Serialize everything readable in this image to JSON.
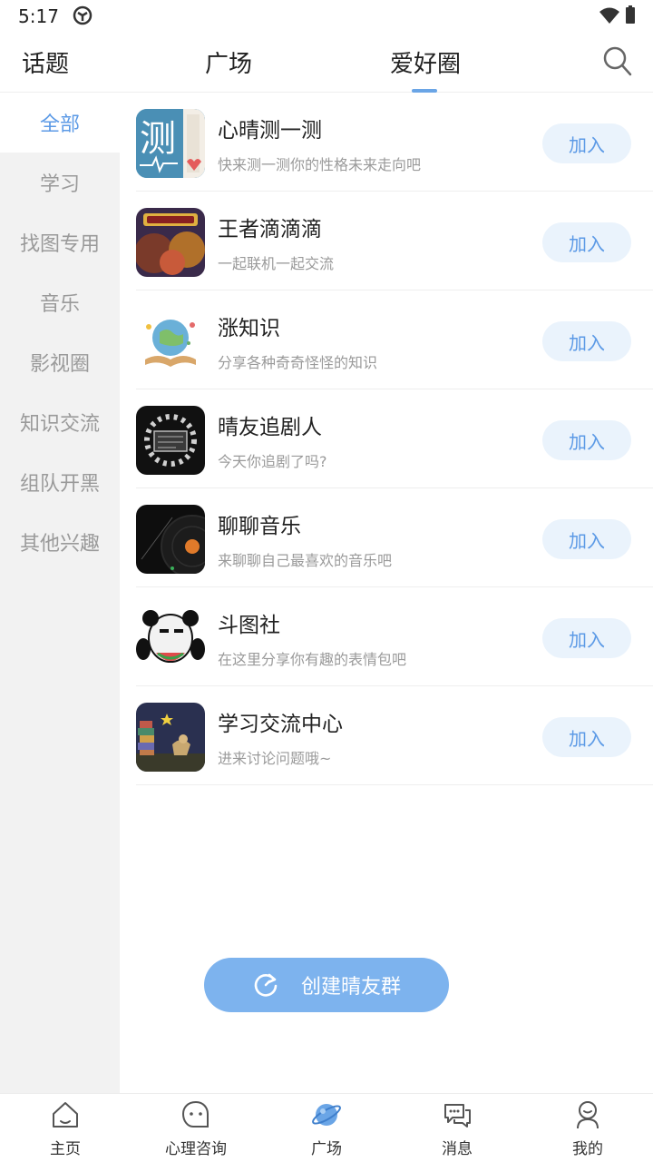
{
  "status_bar": {
    "time": "5:17"
  },
  "top_tabs": [
    {
      "label": "话题"
    },
    {
      "label": "广场"
    },
    {
      "label": "爱好圈",
      "active": true
    }
  ],
  "sidebar": {
    "items": [
      {
        "label": "全部",
        "active": true
      },
      {
        "label": "学习"
      },
      {
        "label": "找图专用"
      },
      {
        "label": "音乐"
      },
      {
        "label": "影视圈"
      },
      {
        "label": "知识交流"
      },
      {
        "label": "组队开黑"
      },
      {
        "label": "其他兴趣"
      }
    ]
  },
  "groups": [
    {
      "title": "心晴测一测",
      "desc": "快来测一测你的性格未来走向吧",
      "join": "加入",
      "thumb": "测"
    },
    {
      "title": "王者滴滴滴",
      "desc": "一起联机一起交流",
      "join": "加入"
    },
    {
      "title": "涨知识",
      "desc": "分享各种奇奇怪怪的知识",
      "join": "加入"
    },
    {
      "title": "晴友追剧人",
      "desc": "今天你追剧了吗?",
      "join": "加入"
    },
    {
      "title": "聊聊音乐",
      "desc": "来聊聊自己最喜欢的音乐吧",
      "join": "加入"
    },
    {
      "title": "斗图社",
      "desc": "在这里分享你有趣的表情包吧",
      "join": "加入"
    },
    {
      "title": "学习交流中心",
      "desc": "进来讨论问题哦~",
      "join": "加入"
    }
  ],
  "create_button": {
    "label": "创建晴友群"
  },
  "bottom_nav": [
    {
      "label": "主页",
      "icon": "home-icon"
    },
    {
      "label": "心理咨询",
      "icon": "face-chat-icon"
    },
    {
      "label": "广场",
      "icon": "planet-icon",
      "active": true
    },
    {
      "label": "消息",
      "icon": "chat-bubbles-icon"
    },
    {
      "label": "我的",
      "icon": "user-icon"
    }
  ],
  "colors": {
    "accent": "#5c9ae6",
    "join_bg": "#eaf3fc",
    "create_bg": "#7db3ee",
    "sidebar_bg": "#f2f2f2"
  }
}
